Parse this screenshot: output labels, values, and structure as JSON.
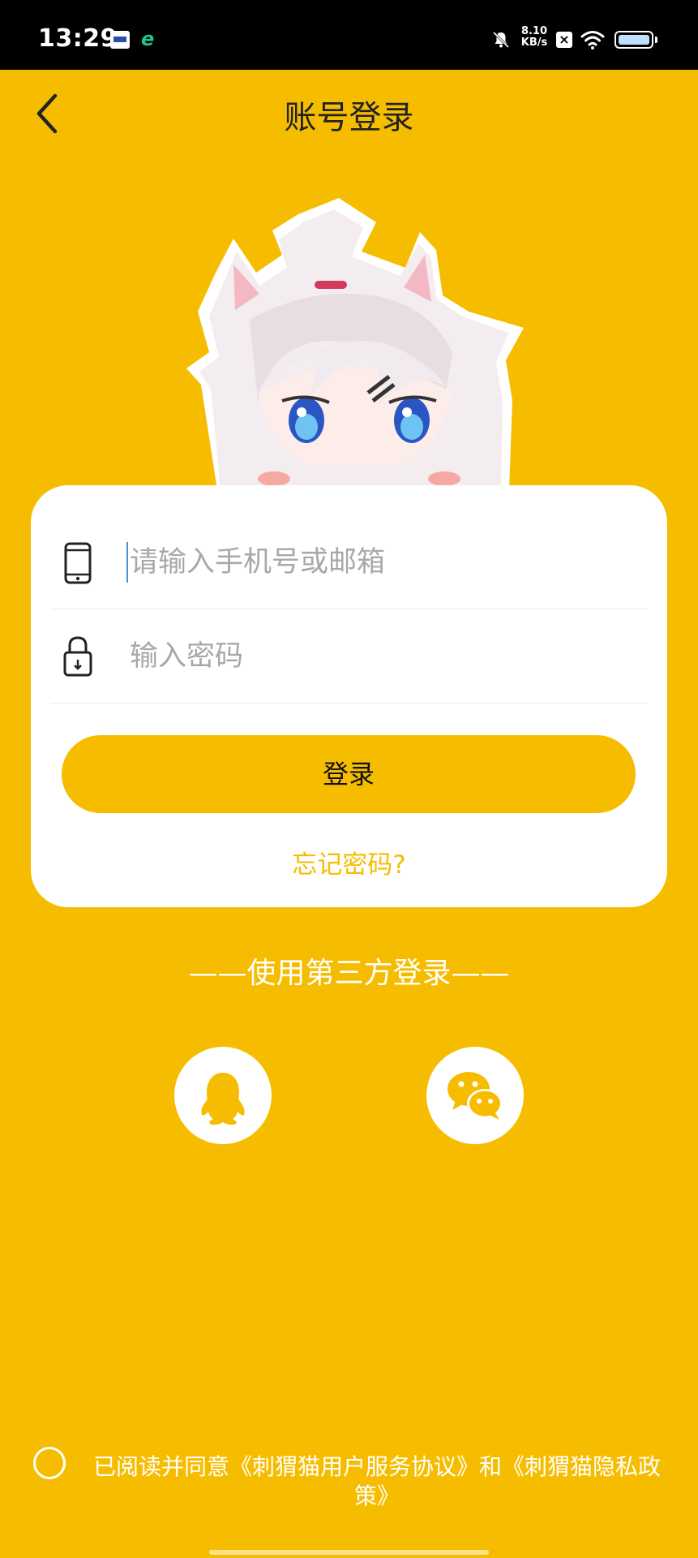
{
  "status_bar": {
    "time": "13:29",
    "network_speed_value": "8.10",
    "network_speed_unit": "KB/s",
    "app_icon_2": "e",
    "close_badge": "×",
    "icons": [
      "bell-off-icon",
      "wifi-icon",
      "battery-icon"
    ]
  },
  "header": {
    "title": "账号登录",
    "back_icon": "chevron-left-icon"
  },
  "form": {
    "phone_placeholder": "请输入手机号或邮箱",
    "phone_value": "",
    "password_placeholder": "输入密码",
    "password_value": "",
    "login_label": "登录",
    "forgot_label": "忘记密码?"
  },
  "third_party": {
    "label": "——使用第三方登录——",
    "providers": [
      "qq-icon",
      "wechat-icon"
    ]
  },
  "agreement": {
    "text": "已阅读并同意《刺猬猫用户服务协议》和《刺猬猫隐私政策》",
    "checked": false
  },
  "colors": {
    "background": "#F6BD00",
    "accent": "#F6BD00",
    "card": "#FFFFFF",
    "status_bar": "#000000"
  }
}
